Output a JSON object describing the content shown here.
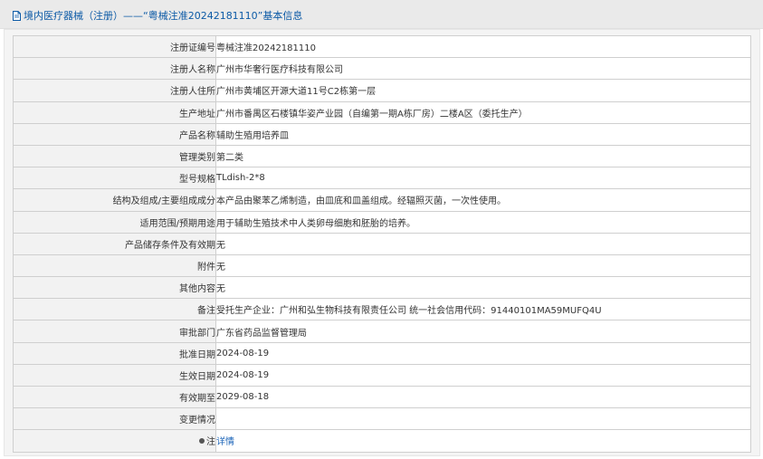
{
  "header": {
    "title": "境内医疗器械（注册）——“粤械注准20242181110”基本信息"
  },
  "rows": [
    {
      "label": "注册证编号",
      "value": "粤械注准20242181110"
    },
    {
      "label": "注册人名称",
      "value": "广州市华奢行医疗科技有限公司"
    },
    {
      "label": "注册人住所",
      "value": "广州市黄埔区开源大道11号C2栋第一层"
    },
    {
      "label": "生产地址",
      "value": "广州市番禺区石楼镇华姿产业园（自编第一期A栋厂房）二楼A区（委托生产）"
    },
    {
      "label": "产品名称",
      "value": "辅助生殖用培养皿"
    },
    {
      "label": "管理类别",
      "value": "第二类"
    },
    {
      "label": "型号规格",
      "value": "TLdish-2*8"
    },
    {
      "label": "结构及组成/主要组成成分",
      "value": "本产品由聚苯乙烯制造，由皿底和皿盖组成。经辐照灭菌，一次性使用。"
    },
    {
      "label": "适用范围/预期用途",
      "value": "用于辅助生殖技术中人类卵母细胞和胚胎的培养。"
    },
    {
      "label": "产品储存条件及有效期",
      "value": "无"
    },
    {
      "label": "附件",
      "value": "无"
    },
    {
      "label": "其他内容",
      "value": "无"
    },
    {
      "label": "备注",
      "value": "受托生产企业：广州和弘生物科技有限责任公司 统一社会信用代码：91440101MA59MUFQ4U"
    },
    {
      "label": "审批部门",
      "value": "广东省药品监督管理局"
    },
    {
      "label": "批准日期",
      "value": "2024-08-19"
    },
    {
      "label": "生效日期",
      "value": "2024-08-19"
    },
    {
      "label": "有效期至",
      "value": "2029-08-18"
    },
    {
      "label": "变更情况",
      "value": ""
    }
  ],
  "note": {
    "label": "注",
    "link_text": "详情",
    "icon": "location-pin-icon"
  }
}
